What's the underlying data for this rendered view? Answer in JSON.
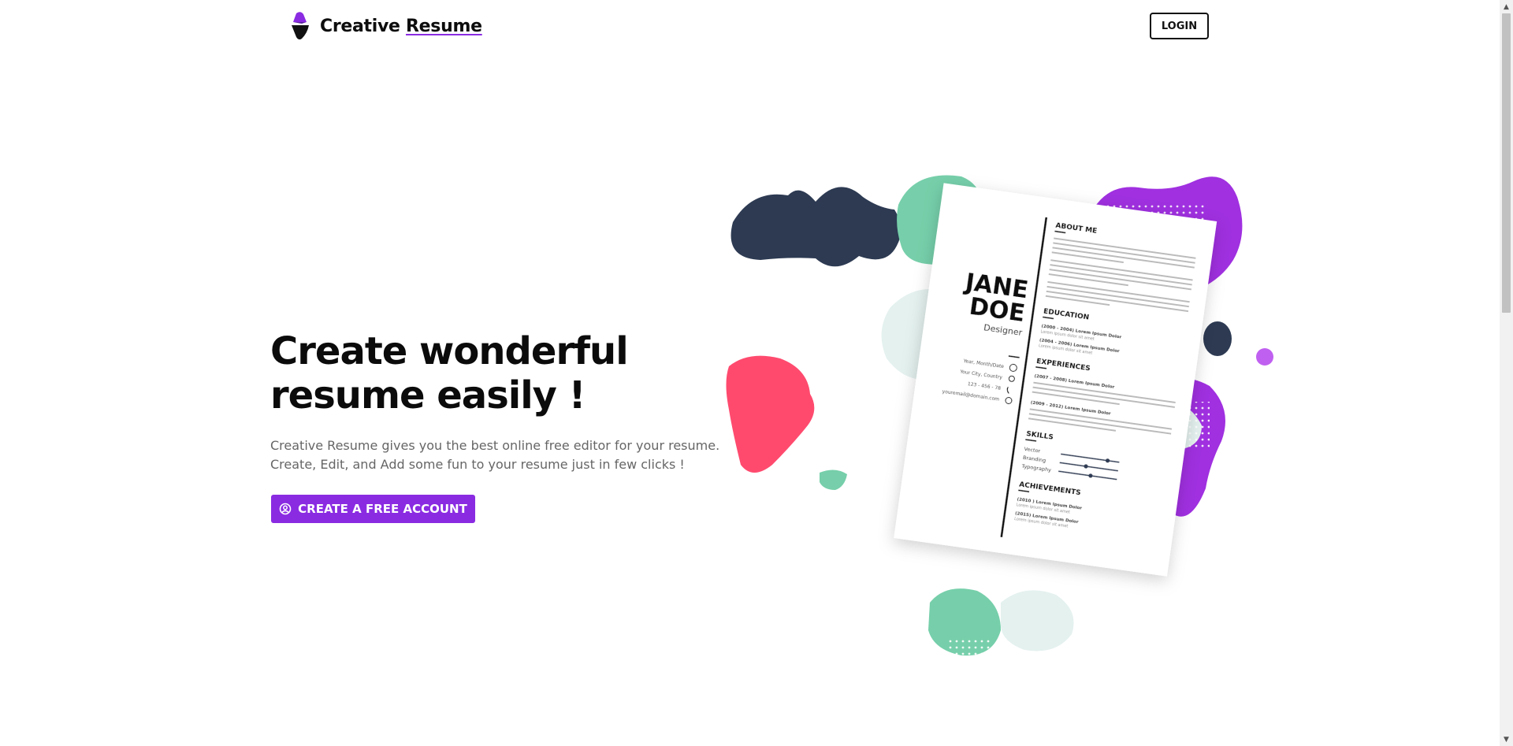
{
  "header": {
    "brand_primary": "Creative",
    "brand_accent": "Resume",
    "login_label": "LOGIN"
  },
  "hero": {
    "title_line1": "Create wonderful",
    "title_line2": "resume easily !",
    "description_line1": "Creative Resume gives you the best online free editor for your resume.",
    "description_line2": "Create, Edit, and Add some fun to your resume just in few clicks !",
    "cta_label": "CREATE A FREE ACCOUNT",
    "cta_icon": "user-circle-icon"
  },
  "resume_preview": {
    "name_line1": "JANE",
    "name_line2": "DOE",
    "role": "Designer",
    "contact": [
      "Year, Month/Date",
      "Your City, Country",
      "123 - 456 - 78",
      "youremail@domain.com"
    ],
    "about_heading": "ABOUT ME",
    "education_heading": "EDUCATION",
    "education_items": [
      "(2000 - 2004) Lorem Ipsum Dolor",
      "(2004 - 2006) Lorem Ipsum Dolor"
    ],
    "experiences_heading": "EXPERIENCES",
    "experience_items": [
      "(2007 - 2008) Lorem Ipsum Dolor",
      "(2009 - 2012) Lorem Ipsum Dolor"
    ],
    "skills_heading": "SKILLS",
    "skills": [
      "Vector",
      "Branding",
      "Typography"
    ],
    "skill_levels": [
      0.8,
      0.45,
      0.55
    ],
    "achievements_heading": "ACHIEVEMENTS",
    "achievement_items": [
      "(2010 ) Lorem Ipsum Dolor",
      "(2015) Lorem Ipsum Dolor"
    ],
    "filler_text": "Lorem ipsum dolor sit amet"
  },
  "colors": {
    "accent": "#8a2be2",
    "navy": "#2d3a52",
    "pink": "#ff4a6e",
    "mint": "#76cfaa",
    "pale": "#e4f1ef"
  }
}
